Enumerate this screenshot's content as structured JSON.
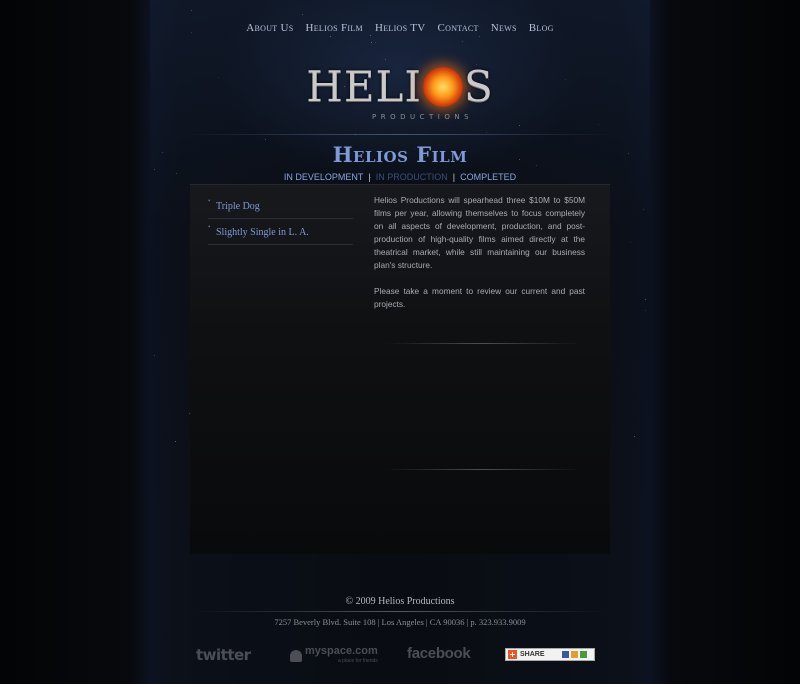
{
  "nav": {
    "items": [
      "About Us",
      "Helios Film",
      "Helios TV",
      "Contact",
      "News",
      "Blog"
    ]
  },
  "logo": {
    "word_left": "HELI",
    "word_right": "S",
    "subtitle": "PRODUCTIONS"
  },
  "section": {
    "title": "Helios Film"
  },
  "tabs": [
    {
      "label": "IN DEVELOPMENT",
      "active": false
    },
    {
      "label": "IN PRODUCTION",
      "active": true
    },
    {
      "label": "COMPLETED",
      "active": false
    }
  ],
  "tab_separator": "|",
  "projects": [
    "Triple Dog",
    "Slightly Single in L. A."
  ],
  "description": {
    "paragraph_1": "Helios Productions will spearhead three $10M to $50M films per year, allowing themselves to focus completely on all aspects of development, production, and post-production of high-quality films aimed directly at the theatrical market, while still maintaining our business plan's structure.",
    "paragraph_2": "Please take a moment to review our current and past projects."
  },
  "footer": {
    "copyright": "© 2009 Helios Productions",
    "address": "7257 Beverly Blvd. Suite 108 | Los Angeles | CA 90036 | p. 323.933.9009"
  },
  "social": {
    "twitter": "twitter",
    "myspace": "myspace.com",
    "myspace_tagline": "a place for friends",
    "facebook": "facebook",
    "share": "SHARE"
  },
  "colors": {
    "accent_blue": "#7f9ad6",
    "active_tab": "#3a4f7a",
    "sun_orange": "#ff9a1a",
    "share_orange": "#e8562a"
  },
  "icons": [
    "sun-logo-icon",
    "myspace-icon",
    "share-plus-icon"
  ]
}
